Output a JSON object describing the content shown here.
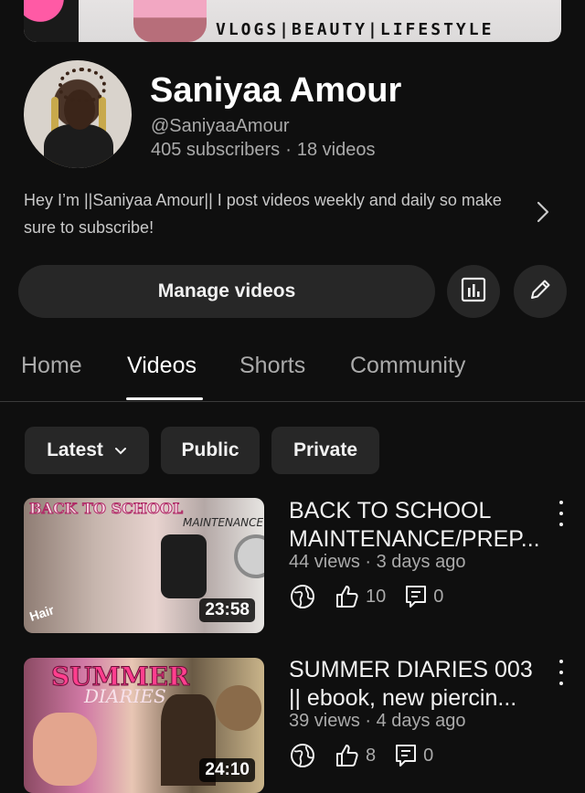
{
  "banner": {
    "tagline": "VLOGS|BEAUTY|LIFESTYLE"
  },
  "channel": {
    "name": "Saniyaa Amour",
    "handle": "@SaniyaaAmour",
    "subscribers": "405 subscribers",
    "separator": "·",
    "videos_count": "18 videos",
    "description": "Hey I’m ||Saniyaa Amour|| I post videos weekly and daily so make sure to subscribe!"
  },
  "actions": {
    "manage_label": "Manage videos"
  },
  "tabs": [
    {
      "label": "Home",
      "active": false
    },
    {
      "label": "Videos",
      "active": true
    },
    {
      "label": "Shorts",
      "active": false
    },
    {
      "label": "Community",
      "active": false
    }
  ],
  "filters": [
    {
      "label": "Latest",
      "dropdown": true
    },
    {
      "label": "Public"
    },
    {
      "label": "Private"
    }
  ],
  "videos": [
    {
      "title_line1": "BACK TO SCHOOL",
      "title_line2": "MAINTENANCE/PREP...",
      "meta": "44 views · 3 days ago",
      "likes": "10",
      "comments": "0",
      "duration": "23:58",
      "thumb_text_main": "BACK TO SCHOOL",
      "thumb_text_sub": "MAINTENANCE",
      "thumb_text_hair": "Hair"
    },
    {
      "title_line1": "SUMMER DIARIES 003",
      "title_line2": "|| ebook, new piercin...",
      "meta": "39 views · 4 days ago",
      "likes": "8",
      "comments": "0",
      "duration": "24:10",
      "thumb_text_main": "SUMMER",
      "thumb_text_sub": "DIARIES"
    }
  ],
  "colors": {
    "background": "#0f0f0f",
    "chip_bg": "#272727",
    "muted_text": "#aaaaaa",
    "brand_pink": "#ff2f8f"
  }
}
